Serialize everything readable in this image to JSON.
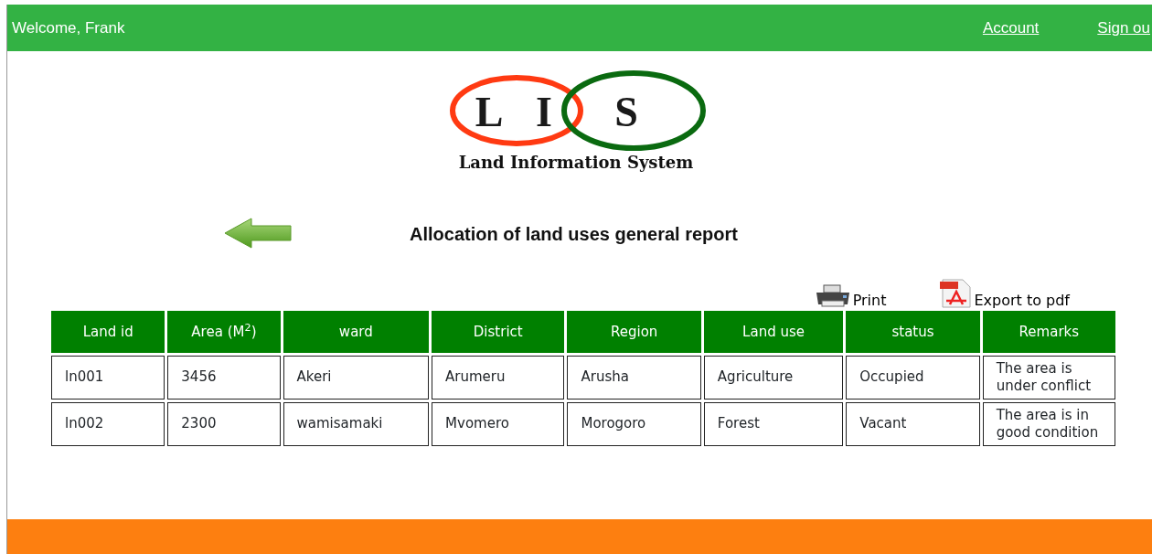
{
  "header": {
    "welcome": "Welcome, Frank",
    "links": [
      "Account",
      "Sign ou"
    ]
  },
  "logo": {
    "letters": [
      "L",
      "I",
      "S"
    ],
    "caption": "Land Information System"
  },
  "report": {
    "title": "Allocation of land uses general report"
  },
  "actions": [
    {
      "kind": "print",
      "label": "Print"
    },
    {
      "kind": "pdf",
      "label": "Export to pdf"
    }
  ],
  "table": {
    "columns": [
      "Land id",
      "Area (M$^{2}$)",
      "ward",
      "District",
      "Region",
      "Land use",
      "status",
      "Remarks"
    ],
    "rows": [
      [
        "ln001",
        "3456",
        "Akeri",
        "Arumeru",
        "Arusha",
        "Agriculture",
        "Occupied",
        "The area is under conflict"
      ],
      [
        "ln002",
        "2300",
        "wamisamaki",
        "Mvomero",
        "Morogoro",
        "Forest",
        "Vacant",
        "The area is in good condition"
      ]
    ]
  }
}
